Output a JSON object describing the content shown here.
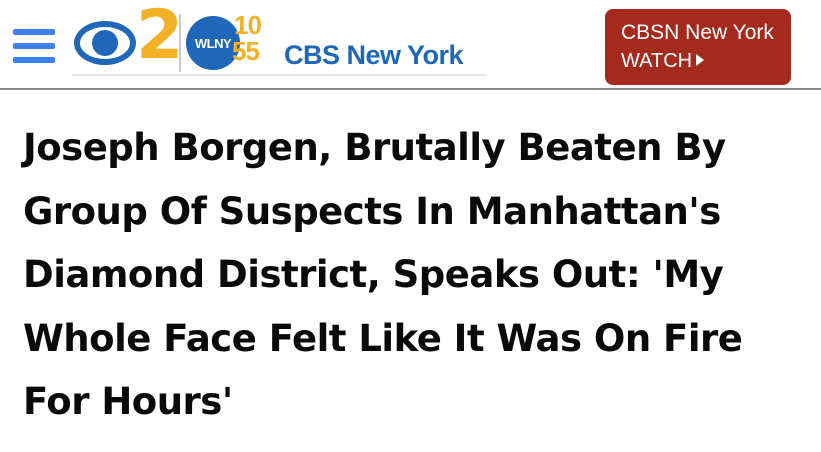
{
  "header": {
    "menu_icon": "hamburger-menu-icon",
    "logo": {
      "channel_number": "2",
      "wlny_label": "WLNY",
      "wlny_number_top": "10",
      "wlny_number_bottom": "55",
      "brand_text": "CBS New York",
      "colors": {
        "cbs_blue": "#1f67b8",
        "gold": "#f2b126"
      }
    },
    "watch_button": {
      "line1": "CBSN New York",
      "line2": "WATCH",
      "icon": "play-triangle-icon",
      "color": "#a32a1c"
    },
    "menu_color": "#3b82f0"
  },
  "article": {
    "headline": "Joseph Borgen, Brutally Beaten By Group Of Suspects In Manhattan's Diamond District, Speaks Out: 'My Whole Face Felt Like It Was On Fire For Hours'"
  }
}
